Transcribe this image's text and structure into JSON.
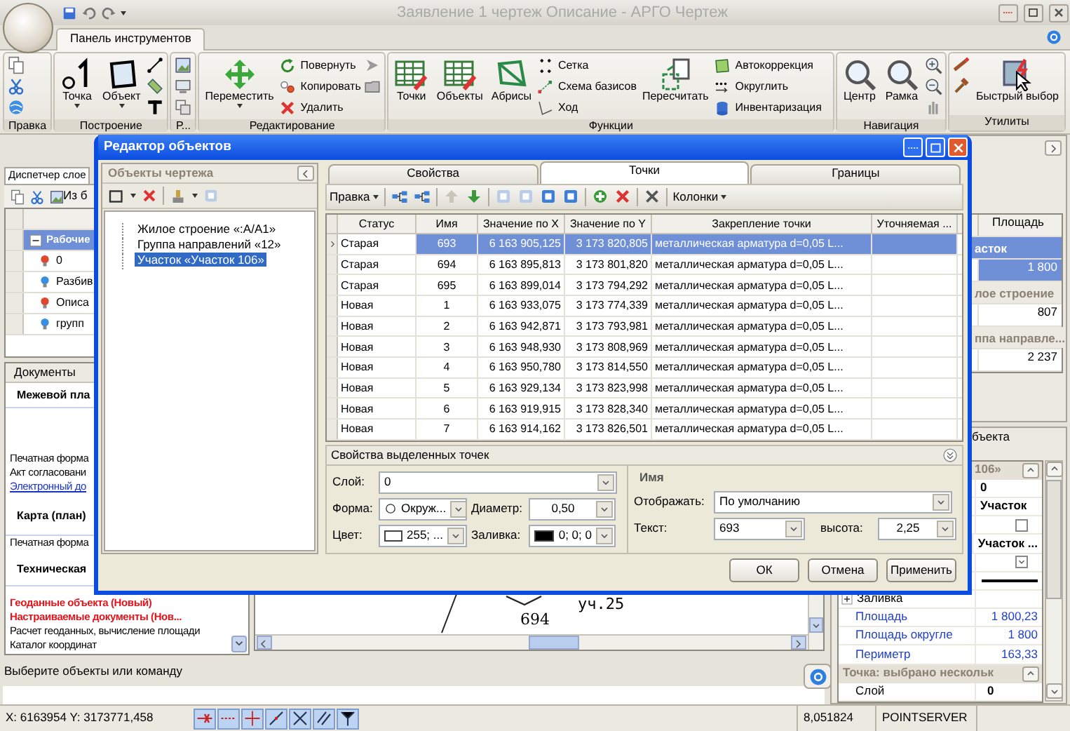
{
  "window": {
    "title": "Заявление 1 чертеж Описание - АРГО Чертеж"
  },
  "ribbon": {
    "tabs": [
      {
        "label": "Панель инструментов",
        "selected": true
      }
    ],
    "groups": [
      {
        "label": "Правка",
        "items": [
          {
            "kind": "icon"
          },
          {
            "kind": "icon"
          },
          {
            "kind": "icon"
          }
        ]
      },
      {
        "label": "Построение",
        "items": [
          {
            "kind": "split",
            "label": "Точка"
          },
          {
            "kind": "split",
            "label": "Объект"
          },
          {
            "kind": "icon"
          },
          {
            "kind": "icon"
          },
          {
            "kind": "icon"
          }
        ]
      },
      {
        "label": "Р...",
        "items": [
          {
            "kind": "icon"
          },
          {
            "kind": "icon"
          },
          {
            "kind": "icon"
          }
        ]
      },
      {
        "label": "Редактирование",
        "items": [
          {
            "kind": "split",
            "label": "Переместить"
          },
          {
            "kind": "small",
            "label": "Повернуть"
          },
          {
            "kind": "small",
            "label": "Копировать"
          },
          {
            "kind": "small",
            "label": "Удалить"
          },
          {
            "kind": "icon"
          },
          {
            "kind": "icon"
          }
        ]
      },
      {
        "label": "Функции",
        "items": [
          {
            "kind": "large",
            "label": "Точки"
          },
          {
            "kind": "large",
            "label": "Объекты"
          },
          {
            "kind": "large",
            "label": "Абрисы"
          },
          {
            "kind": "small",
            "label": "Сетка"
          },
          {
            "kind": "small",
            "label": "Схема базисов"
          },
          {
            "kind": "small",
            "label": "Ход"
          },
          {
            "kind": "large",
            "label": "Пересчитать"
          },
          {
            "kind": "small",
            "label": "Автокоррекция"
          },
          {
            "kind": "small",
            "label": "Округлить"
          },
          {
            "kind": "small",
            "label": "Инвентаризация"
          }
        ]
      },
      {
        "label": "Навигация",
        "items": [
          {
            "kind": "large",
            "label": "Центр"
          },
          {
            "kind": "large",
            "label": "Рамка"
          },
          {
            "kind": "icon"
          },
          {
            "kind": "icon"
          },
          {
            "kind": "icon"
          }
        ]
      },
      {
        "label": "Утилиты",
        "items": [
          {
            "kind": "icon"
          },
          {
            "kind": "icon"
          },
          {
            "kind": "large",
            "label": "Быстрый выбор"
          }
        ]
      }
    ]
  },
  "layers_panel": {
    "tab": "Диспетчер слое",
    "toolbar_label": "Из б",
    "group": {
      "label": "Рабочие",
      "expanded": true
    },
    "layers": [
      {
        "name": "0",
        "color": "#e0452e"
      },
      {
        "name": "Разбив",
        "color": "#3b8de0"
      },
      {
        "name": "Описа",
        "color": "#e0452e"
      },
      {
        "name": "групп",
        "color": "#3b8de0"
      }
    ]
  },
  "documents": {
    "title": "Документы",
    "sections": [
      {
        "heading": "Межевой пла",
        "items": [
          {
            "kind": "plain",
            "text": "Печатная форма"
          },
          {
            "kind": "plain",
            "text": "Акт согласовани"
          },
          {
            "kind": "link",
            "text": "Электронный до"
          }
        ]
      },
      {
        "heading": "Карта (план)",
        "items": [
          {
            "kind": "plain",
            "text": "Печатная форма"
          }
        ]
      },
      {
        "heading": "Техническая",
        "items": [
          {
            "kind": "new",
            "text": "Геоданные объекта (Новый)"
          },
          {
            "kind": "new",
            "text": "Настраиваемые документы (Нов..."
          },
          {
            "kind": "plain",
            "text": "Расчет геоданных, вычисление площади"
          },
          {
            "kind": "plain",
            "text": "Каталог координат"
          }
        ]
      }
    ]
  },
  "canvas": {
    "parcel_label": "уч.25",
    "point_label": "694"
  },
  "command_prompt": "Выберите объекты или команду",
  "area_panel": {
    "column": "Площадь",
    "groups": [
      {
        "label": "асток",
        "selected": true,
        "rows": [
          {
            "area": "1 800"
          }
        ]
      },
      {
        "label": "лое строение",
        "selected": false,
        "rows": [
          {
            "area": "807"
          }
        ]
      },
      {
        "label": "ппа направле...",
        "selected": false,
        "rows": [
          {
            "area": "2 237"
          }
        ]
      }
    ]
  },
  "object_properties": {
    "tab": "бъекта",
    "sections": [
      {
        "title": "106»",
        "rows": [
          {
            "kind": "text",
            "value": "0"
          },
          {
            "kind": "text",
            "value": "Участок"
          },
          {
            "kind": "check",
            "checked": false
          },
          {
            "kind": "text",
            "value": "Участок ..."
          },
          {
            "kind": "check",
            "checked": true
          },
          {
            "kind": "line"
          },
          {
            "kind": "category",
            "label": "Заливка",
            "expanded": false
          },
          {
            "kind": "computed",
            "label": "Площадь",
            "value": "1 800,23"
          },
          {
            "kind": "computed",
            "label": "Площадь округле",
            "value": "1 800"
          },
          {
            "kind": "computed",
            "label": "Периметр",
            "value": "163,33"
          }
        ]
      },
      {
        "title": "Точка: выбрано нескольк",
        "rows": [
          {
            "kind": "pair",
            "label": "Слой",
            "value": "0"
          }
        ]
      }
    ]
  },
  "status_bar": {
    "coordinates": "X: 6163954 Y: 3173771,458",
    "scale": "8,051824",
    "server": "POINTSERVER"
  },
  "dialog": {
    "title": "Редактор объектов",
    "objects_pane": {
      "title": "Объекты чертежа",
      "tree": [
        {
          "label": "Жилое строение «:А/А1»",
          "selected": false
        },
        {
          "label": "Группа направлений «12»",
          "selected": false
        },
        {
          "label": "Участок «Участок 106»",
          "selected": true
        }
      ]
    },
    "tabs": [
      {
        "label": "Свойства",
        "selected": false
      },
      {
        "label": "Точки",
        "selected": true
      },
      {
        "label": "Границы",
        "selected": false
      }
    ],
    "toolbar": {
      "menus": [
        "Правка",
        "Колонки"
      ]
    },
    "table": {
      "columns": [
        "Статус",
        "Имя",
        "Значение по X",
        "Значение по Y",
        "Закрепление точки",
        "Уточняемая ..."
      ],
      "rows": [
        {
          "selected": true,
          "cells": [
            "Старая",
            "693",
            "6 163 905,125",
            "3 173 820,805",
            "металлическая арматура d=0,05 L...",
            ""
          ]
        },
        {
          "selected": false,
          "cells": [
            "Старая",
            "694",
            "6 163 895,813",
            "3 173 801,820",
            "металлическая арматура d=0,05 L...",
            ""
          ]
        },
        {
          "selected": false,
          "cells": [
            "Старая",
            "695",
            "6 163 899,014",
            "3 173 794,292",
            "металлическая арматура d=0,05 L...",
            ""
          ]
        },
        {
          "selected": false,
          "cells": [
            "Новая",
            "1",
            "6 163 933,075",
            "3 173 774,339",
            "металлическая арматура d=0,05 L...",
            ""
          ]
        },
        {
          "selected": false,
          "cells": [
            "Новая",
            "2",
            "6 163 942,871",
            "3 173 793,981",
            "металлическая арматура d=0,05 L...",
            ""
          ]
        },
        {
          "selected": false,
          "cells": [
            "Новая",
            "3",
            "6 163 948,930",
            "3 173 808,969",
            "металлическая арматура d=0,05 L...",
            ""
          ]
        },
        {
          "selected": false,
          "cells": [
            "Новая",
            "4",
            "6 163 950,780",
            "3 173 814,550",
            "металлическая арматура d=0,05 L...",
            ""
          ]
        },
        {
          "selected": false,
          "cells": [
            "Новая",
            "5",
            "6 163 929,134",
            "3 173 823,998",
            "металлическая арматура d=0,05 L...",
            ""
          ]
        },
        {
          "selected": false,
          "cells": [
            "Новая",
            "6",
            "6 163 919,915",
            "3 173 828,340",
            "металлическая арматура d=0,05 L...",
            ""
          ]
        },
        {
          "selected": false,
          "cells": [
            "Новая",
            "7",
            "6 163 914,162",
            "3 173 826,501",
            "металлическая арматура d=0,05 L...",
            ""
          ]
        }
      ]
    },
    "properties": {
      "title": "Свойства выделенных точек",
      "layer": {
        "label": "Слой:",
        "value": "0"
      },
      "shape": {
        "label": "Форма:",
        "value": "Окруж..."
      },
      "diameter": {
        "label": "Диаметр:",
        "value": "0,50"
      },
      "color": {
        "label": "Цвет:",
        "value": "255; ...",
        "color": "#ffffff"
      },
      "fill": {
        "label": "Заливка:",
        "value": "0; 0; 0",
        "color": "#000000"
      },
      "name_group": {
        "title": "Имя",
        "display": {
          "label": "Отображать:",
          "value": "По умолчанию"
        },
        "text": {
          "label": "Текст:",
          "value": "693"
        },
        "height": {
          "label": "высота:",
          "value": "2,25"
        }
      }
    },
    "buttons": [
      "ОК",
      "Отмена",
      "Применить"
    ]
  }
}
